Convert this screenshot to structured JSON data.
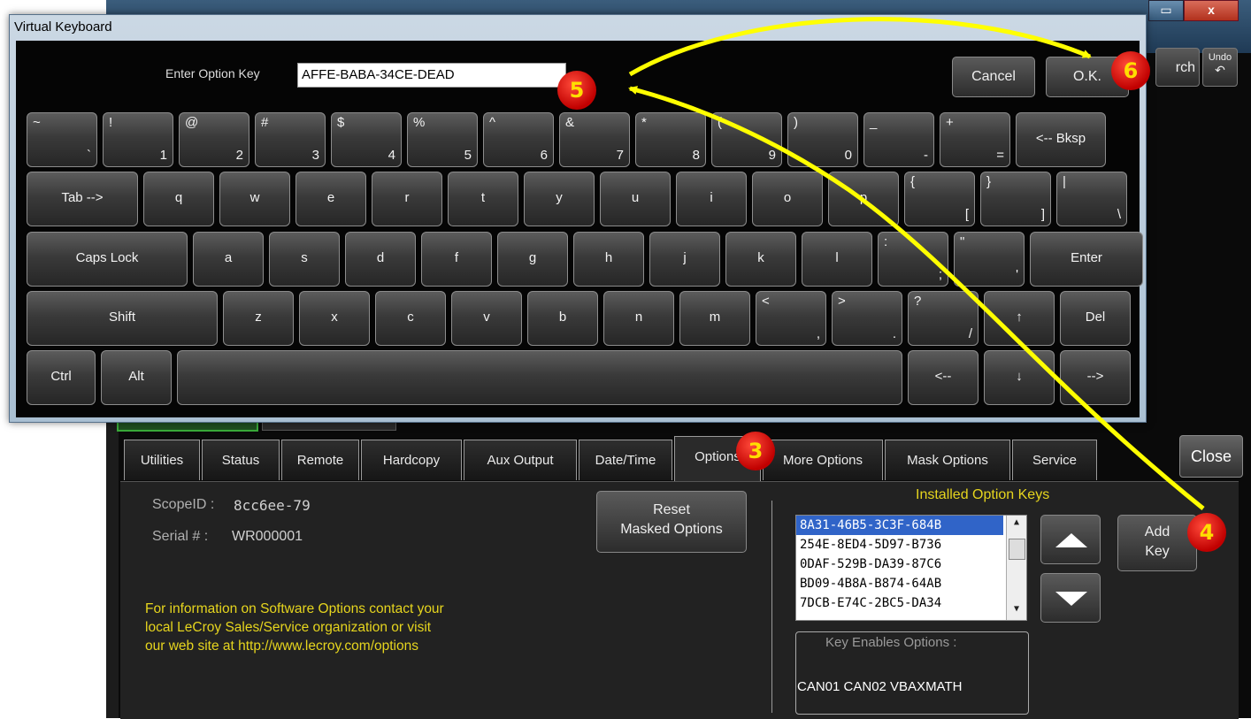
{
  "background_window": {
    "search_label": "rch",
    "undo_label": "Undo",
    "undo_icon": "↶",
    "min_icon": "▭",
    "close_icon": "x",
    "close_button": "Close"
  },
  "tabs": [
    {
      "label": "Utilities",
      "active": false
    },
    {
      "label": "Status",
      "active": false
    },
    {
      "label": "Remote",
      "active": false
    },
    {
      "label": "Hardcopy",
      "active": false
    },
    {
      "label": "Aux Output",
      "active": false
    },
    {
      "label": "Date/Time",
      "active": false
    },
    {
      "label": "Options",
      "active": true
    },
    {
      "label": "More Options",
      "active": false
    },
    {
      "label": "Mask Options",
      "active": false
    },
    {
      "label": "Service",
      "active": false
    }
  ],
  "options_panel": {
    "scope_id_label": "ScopeID :",
    "scope_id_value": "8cc6ee-79",
    "serial_label": "Serial # :",
    "serial_value": "WR000001",
    "info_line1": "For information on Software Options contact your",
    "info_line2": "local LeCroy Sales/Service organization or visit",
    "info_line3": "our web site at http://www.lecroy.com/options",
    "reset_line1": "Reset",
    "reset_line2": "Masked Options",
    "installed_title": "Installed Option Keys",
    "installed_keys": [
      "8A31-46B5-3C3F-684B",
      "254E-8ED4-5D97-B736",
      "0DAF-529B-DA39-87C6",
      "BD09-4B8A-B874-64AB",
      "7DCB-E74C-2BC5-DA34"
    ],
    "selected_key_index": 0,
    "add_key_line1": "Add",
    "add_key_line2": "Key",
    "enables_title": "Key Enables Options :",
    "enables_value": "CAN01 CAN02 VBAXMATH"
  },
  "virtual_keyboard": {
    "title": "Virtual Keyboard",
    "prompt_label": "Enter Option Key",
    "input_value": "AFFE-BABA-34CE-DEAD",
    "cancel_label": "Cancel",
    "ok_label": "O.K.",
    "row1": [
      {
        "top": "~",
        "bottom": "`"
      },
      {
        "top": "!",
        "bottom": "1"
      },
      {
        "top": "@",
        "bottom": "2"
      },
      {
        "top": "#",
        "bottom": "3"
      },
      {
        "top": "$",
        "bottom": "4"
      },
      {
        "top": "%",
        "bottom": "5"
      },
      {
        "top": "^",
        "bottom": "6"
      },
      {
        "top": "&",
        "bottom": "7"
      },
      {
        "top": "*",
        "bottom": "8"
      },
      {
        "top": "(",
        "bottom": "9"
      },
      {
        "top": ")",
        "bottom": "0"
      },
      {
        "top": "_",
        "bottom": "-"
      },
      {
        "top": "+",
        "bottom": "="
      },
      {
        "center": "<-- Bksp"
      }
    ],
    "row2": [
      {
        "center": "Tab -->"
      },
      {
        "center": "q"
      },
      {
        "center": "w"
      },
      {
        "center": "e"
      },
      {
        "center": "r"
      },
      {
        "center": "t"
      },
      {
        "center": "y"
      },
      {
        "center": "u"
      },
      {
        "center": "i"
      },
      {
        "center": "o"
      },
      {
        "center": "p"
      },
      {
        "top": "{",
        "bottom": "["
      },
      {
        "top": "}",
        "bottom": "]"
      },
      {
        "top": "|",
        "bottom": "\\"
      }
    ],
    "row3": [
      {
        "center": "Caps Lock"
      },
      {
        "center": "a"
      },
      {
        "center": "s"
      },
      {
        "center": "d"
      },
      {
        "center": "f"
      },
      {
        "center": "g"
      },
      {
        "center": "h"
      },
      {
        "center": "j"
      },
      {
        "center": "k"
      },
      {
        "center": "l"
      },
      {
        "top": ":",
        "bottom": ";"
      },
      {
        "top": "\"",
        "bottom": "'"
      },
      {
        "center": "Enter"
      }
    ],
    "row4": [
      {
        "center": "Shift"
      },
      {
        "center": "z"
      },
      {
        "center": "x"
      },
      {
        "center": "c"
      },
      {
        "center": "v"
      },
      {
        "center": "b"
      },
      {
        "center": "n"
      },
      {
        "center": "m"
      },
      {
        "top": "<",
        "bottom": ","
      },
      {
        "top": ">",
        "bottom": "."
      },
      {
        "top": "?",
        "bottom": "/"
      },
      {
        "center": "↑"
      },
      {
        "center": "Del"
      }
    ],
    "row5": [
      {
        "center": "Ctrl"
      },
      {
        "center": "Alt"
      },
      {
        "center": ""
      },
      {
        "center": "<--"
      },
      {
        "center": "↓"
      },
      {
        "center": "-->"
      }
    ]
  },
  "annotations": [
    {
      "label": "3",
      "color": "#c00000"
    },
    {
      "label": "4",
      "color": "#c00000"
    },
    {
      "label": "5",
      "color": "#c00000"
    },
    {
      "label": "6",
      "color": "#c00000"
    }
  ],
  "colors": {
    "annotation_arrow": "#ffff00",
    "info_text": "#e6d51e",
    "selected_key_bg": "#3064c8"
  }
}
